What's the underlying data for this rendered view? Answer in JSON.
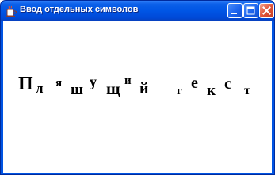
{
  "window": {
    "title": "Ввод отдельных символов"
  },
  "icons": {
    "app": "java-cup-icon",
    "minimize": "minimize-icon",
    "maximize": "maximize-icon",
    "close": "close-icon"
  },
  "canvas": {
    "glyphs": [
      "П",
      "л",
      "я",
      "ш",
      "у",
      "щ",
      "и",
      "й",
      "г",
      "е",
      "к",
      "с",
      "т"
    ]
  },
  "colors": {
    "titlebar": "#0054e3",
    "close_button": "#e0553a",
    "client_background": "#ffffff",
    "text": "#000000"
  }
}
